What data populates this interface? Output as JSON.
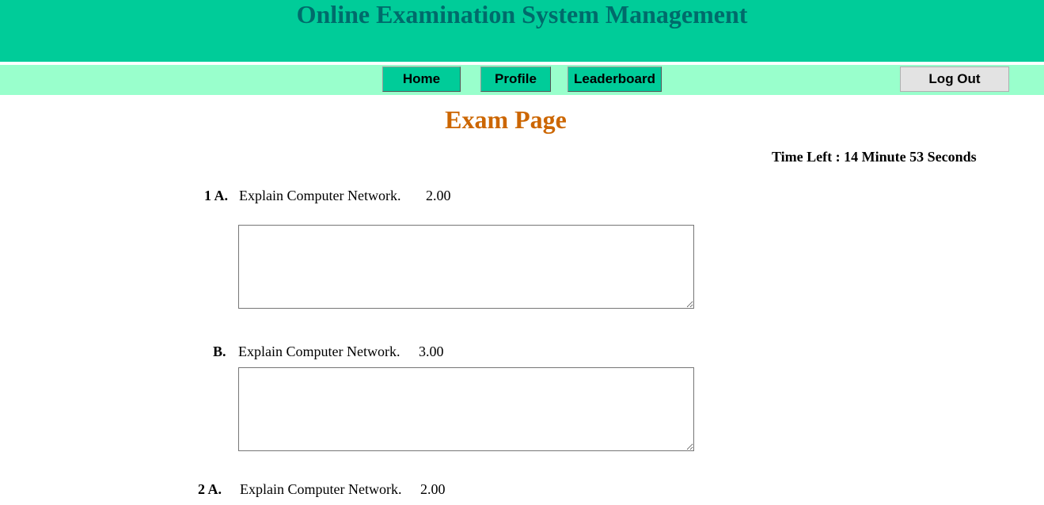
{
  "header": {
    "title": "Online Examination System Management"
  },
  "nav": {
    "home": "Home",
    "profile": "Profile",
    "leaderboard": "Leaderboard",
    "logout": "Log Out"
  },
  "page": {
    "title": "Exam Page",
    "timer": "Time Left : 14 Minute 53 Seconds"
  },
  "questions": [
    {
      "label": "1 A.",
      "text": "Explain Computer Network.",
      "marks": "2.00",
      "answer": ""
    },
    {
      "label": "B.",
      "text": "Explain Computer Network.",
      "marks": "3.00",
      "answer": ""
    },
    {
      "label": "2 A.",
      "text": "Explain Computer Network.",
      "marks": "2.00"
    }
  ],
  "colors": {
    "header_bg": "#00cc99",
    "header_title": "#006b6b",
    "nav_bg": "#99ffcc",
    "page_title": "#cc6600"
  }
}
